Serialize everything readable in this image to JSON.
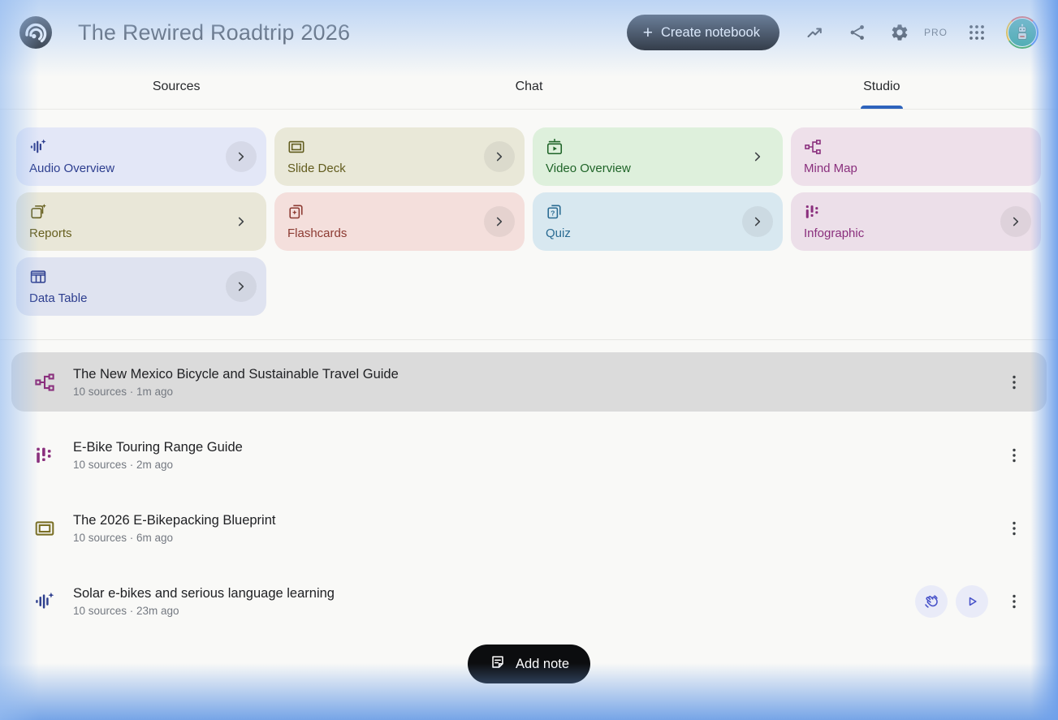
{
  "header": {
    "title": "The Rewired Roadtrip 2026",
    "create_button_label": "Create notebook",
    "pro_label": "PRO",
    "icons": [
      "notebooklm-logo-icon",
      "analytics-icon",
      "share-icon",
      "settings-gear-icon",
      "google-apps-grid-icon",
      "user-avatar"
    ]
  },
  "tabs": [
    {
      "label": "Sources",
      "active": false
    },
    {
      "label": "Chat",
      "active": false
    },
    {
      "label": "Studio",
      "active": true
    }
  ],
  "studio_tools": [
    {
      "label": "Audio Overview",
      "icon": "audio-waveform-sparkle-icon",
      "bg": "#e3e7f7",
      "fg": "#2d3e8f",
      "chevron": "circle"
    },
    {
      "label": "Slide Deck",
      "icon": "slide-deck-icon",
      "bg": "#e9e8d8",
      "fg": "#625c1e",
      "chevron": "circle"
    },
    {
      "label": "Video Overview",
      "icon": "video-overview-icon",
      "bg": "#def0dc",
      "fg": "#1f6428",
      "chevron": "plain"
    },
    {
      "label": "Mind Map",
      "icon": "mind-map-icon",
      "bg": "#eee0ea",
      "fg": "#8a2f7d",
      "chevron": "none"
    },
    {
      "label": "Reports",
      "icon": "report-sparkle-icon",
      "bg": "#e9e7d8",
      "fg": "#665f1e",
      "chevron": "plain"
    },
    {
      "label": "Flashcards",
      "icon": "flashcards-icon",
      "bg": "#f4dfdc",
      "fg": "#8c3a32",
      "chevron": "circle"
    },
    {
      "label": "Quiz",
      "icon": "quiz-icon",
      "bg": "#d8e8f0",
      "fg": "#2a6b92",
      "chevron": "circle"
    },
    {
      "label": "Infographic",
      "icon": "infographic-icon",
      "bg": "#ecdfe9",
      "fg": "#8a2f7d",
      "chevron": "circle"
    },
    {
      "label": "Data Table",
      "icon": "data-table-icon",
      "bg": "#dfe3f0",
      "fg": "#2d3e8f",
      "chevron": "circle"
    }
  ],
  "artifacts": [
    {
      "title": "The New Mexico Bicycle and Sustainable Travel Guide",
      "meta": "10 sources · 1m ago",
      "icon": "mind-map-icon",
      "icon_color": "#8a2f7d",
      "highlighted": true,
      "has_audio_controls": false
    },
    {
      "title": "E-Bike Touring Range Guide",
      "meta": "10 sources · 2m ago",
      "icon": "infographic-icon",
      "icon_color": "#8a2f7d",
      "highlighted": false,
      "has_audio_controls": false
    },
    {
      "title": "The 2026 E-Bikepacking Blueprint",
      "meta": "10 sources · 6m ago",
      "icon": "slide-deck-icon",
      "icon_color": "#7a6f24",
      "highlighted": false,
      "has_audio_controls": false
    },
    {
      "title": "Solar e-bikes and serious language learning",
      "meta": "10 sources · 23m ago",
      "icon": "audio-waveform-sparkle-icon",
      "icon_color": "#30418f",
      "highlighted": false,
      "has_audio_controls": true
    }
  ],
  "add_note": {
    "label": "Add note"
  },
  "colors": {
    "active_tab_underline": "#2d63bc",
    "primary_button_bg": "#0c0d0f",
    "primary_button_fg": "#ffffff",
    "highlighted_row_bg": "#dbdbdb",
    "audio_control_bg": "#e9ebf8",
    "audio_control_fg": "#4853c9",
    "window_glow": "#6fa0e6"
  }
}
